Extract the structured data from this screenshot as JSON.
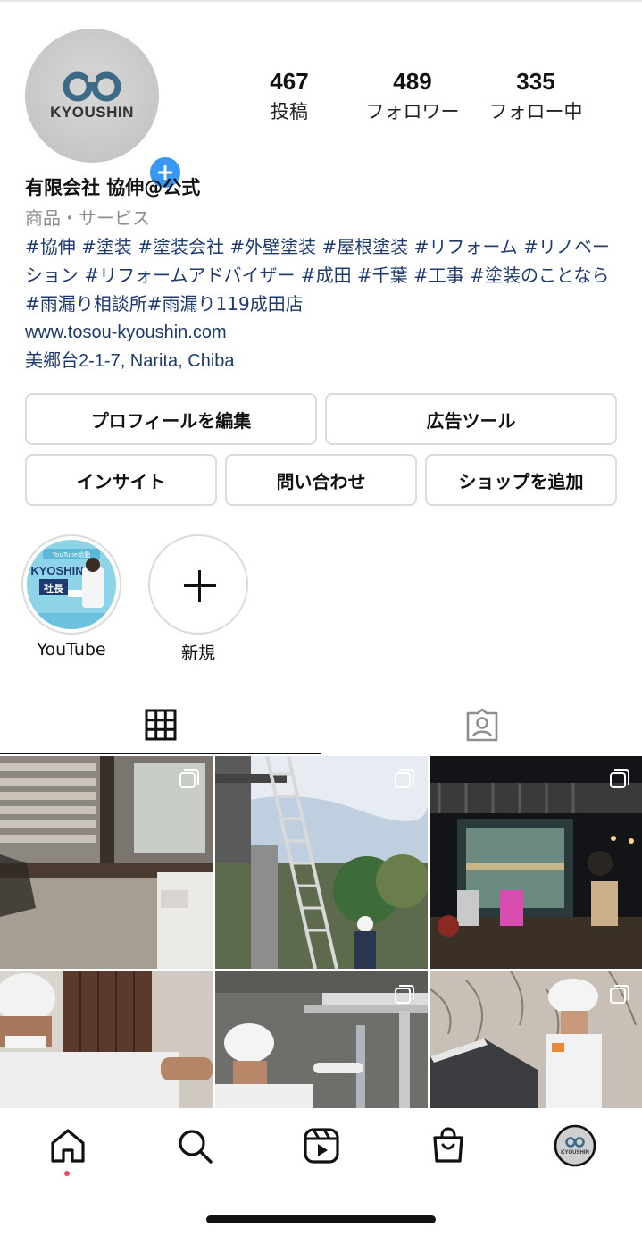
{
  "profile": {
    "avatar_text": "KYOUSHIN",
    "name": "有限会社 協伸@公式",
    "category": "商品・サービス",
    "bio_tags": "#協伸 #塗装 #塗装会社 #外壁塗装 #屋根塗装 #リフォーム #リノベーション #リフォームアドバイザー #成田 #千葉 #工事 #塗装のことなら #雨漏り相談所#雨漏り119成田店",
    "website": "www.tosou-kyoushin.com",
    "address": "美郷台2-1-7, Narita, Chiba"
  },
  "stats": {
    "posts": {
      "value": "467",
      "label": "投稿"
    },
    "followers": {
      "value": "489",
      "label": "フォロワー"
    },
    "following": {
      "value": "335",
      "label": "フォロー中"
    }
  },
  "buttons": {
    "edit_profile": "プロフィールを編集",
    "ad_tools": "広告ツール",
    "insights": "インサイト",
    "contact": "問い合わせ",
    "add_shop": "ショップを追加"
  },
  "highlights": [
    {
      "label": "YouTube",
      "thumb_title": "YouTube始動",
      "thumb_brand": "KYOSHIN",
      "thumb_caption": "社長"
    },
    {
      "label": "新規"
    }
  ],
  "tabs": [
    {
      "name": "grid",
      "icon": "grid-icon",
      "active": true
    },
    {
      "name": "tagged",
      "icon": "tagged-person-icon",
      "active": false
    }
  ],
  "posts": [
    {
      "subject": "louvered window and storage box",
      "multi": true
    },
    {
      "subject": "ladder on scaffolding",
      "multi": true
    },
    {
      "subject": "night cafe terrace",
      "multi": true
    },
    {
      "subject": "worker at brown door",
      "multi": false
    },
    {
      "subject": "worker inspecting gutter",
      "multi": true
    },
    {
      "subject": "worker on roof",
      "multi": true
    }
  ],
  "bottom_nav": [
    {
      "icon": "home-icon",
      "active": true
    },
    {
      "icon": "search-icon"
    },
    {
      "icon": "reels-icon"
    },
    {
      "icon": "shop-icon"
    },
    {
      "icon": "profile-avatar-icon",
      "text": "KYOUSHIN"
    }
  ],
  "colors": {
    "link": "#1e3a6e",
    "accent": "#3897f0",
    "border": "#dbdbdb",
    "muted": "#8e8e8e",
    "notification": "#ed4956"
  }
}
